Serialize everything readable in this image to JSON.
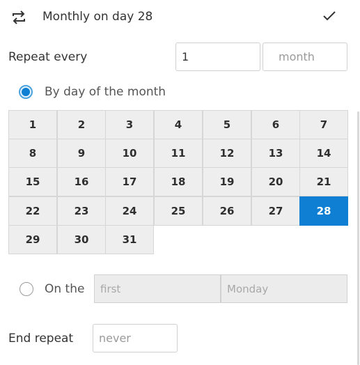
{
  "header": {
    "title": "Monthly on day 28",
    "repeat_icon": "repeat-icon",
    "confirm_icon": "checkmark-icon"
  },
  "repeat_every": {
    "label": "Repeat every",
    "interval_value": "1",
    "unit_placeholder": "month"
  },
  "by_day_of_month": {
    "label": "By day of the month",
    "selected": true,
    "days": [
      "1",
      "2",
      "3",
      "4",
      "5",
      "6",
      "7",
      "8",
      "9",
      "10",
      "11",
      "12",
      "13",
      "14",
      "15",
      "16",
      "17",
      "18",
      "19",
      "20",
      "21",
      "22",
      "23",
      "24",
      "25",
      "26",
      "27",
      "28",
      "29",
      "30",
      "31"
    ],
    "selected_day": "28"
  },
  "on_the": {
    "label": "On the",
    "selected": false,
    "ordinal_placeholder": "first",
    "weekday_placeholder": "Monday"
  },
  "end_repeat": {
    "label": "End repeat",
    "value_placeholder": "never"
  },
  "colors": {
    "accent": "#0e7fd3",
    "day_cell_bg": "#eeeeee",
    "text": "#333333"
  }
}
